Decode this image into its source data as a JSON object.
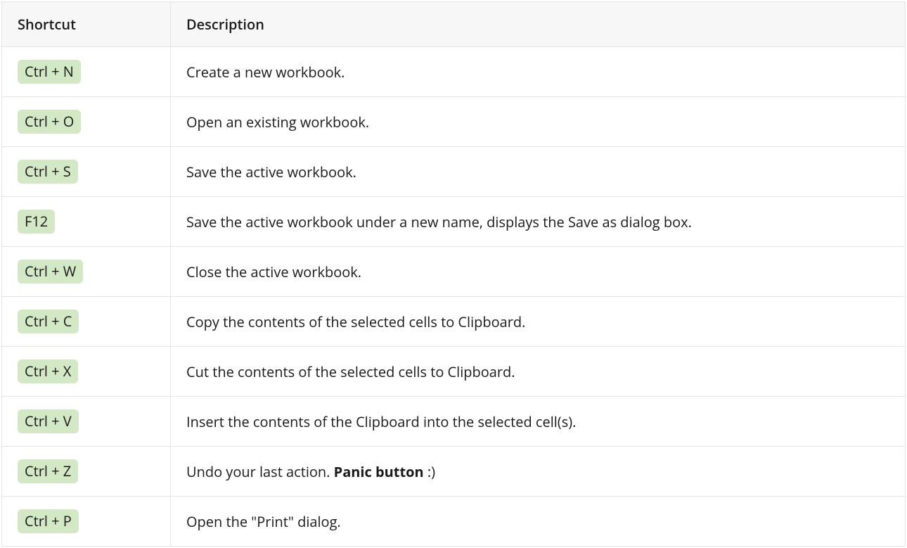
{
  "headers": {
    "shortcut": "Shortcut",
    "description": "Description"
  },
  "rows": [
    {
      "shortcut": "Ctrl + N",
      "description": "Create a new workbook."
    },
    {
      "shortcut": "Ctrl + O",
      "description": "Open an existing workbook."
    },
    {
      "shortcut": "Ctrl + S",
      "description": "Save the active workbook."
    },
    {
      "shortcut": "F12",
      "description": "Save the active workbook under a new name, displays the Save as dialog box."
    },
    {
      "shortcut": "Ctrl + W",
      "description": "Close the active workbook."
    },
    {
      "shortcut": "Ctrl + C",
      "description": "Copy the contents of the selected cells to Clipboard."
    },
    {
      "shortcut": "Ctrl + X",
      "description": "Cut the contents of the selected cells to Clipboard."
    },
    {
      "shortcut": "Ctrl + V",
      "description": "Insert the contents of the Clipboard into the selected cell(s)."
    },
    {
      "shortcut": "Ctrl + Z",
      "description_pre": "Undo your last action. ",
      "description_bold": "Panic button",
      "description_post": " :)"
    },
    {
      "shortcut": "Ctrl + P",
      "description": "Open the \"Print\" dialog."
    }
  ]
}
